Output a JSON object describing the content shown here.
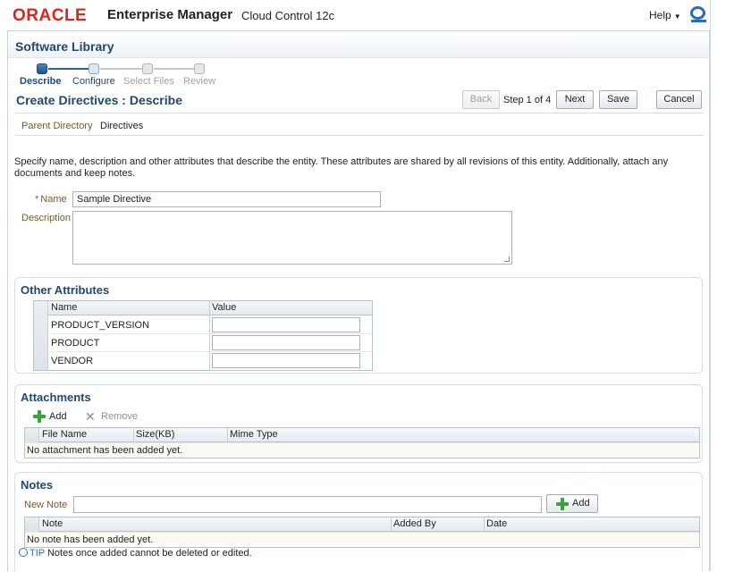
{
  "header": {
    "brand": "ORACLE",
    "product": "Enterprise Manager",
    "edition": "Cloud Control 12c",
    "help_label": "Help"
  },
  "page": {
    "title": "Software Library",
    "subtitle": "Create Directives : Describe",
    "step_info": "Step 1 of 4"
  },
  "train": {
    "steps": [
      {
        "label": "Describe",
        "state": "active"
      },
      {
        "label": "Configure",
        "state": "next"
      },
      {
        "label": "Select Files",
        "state": "todo"
      },
      {
        "label": "Review",
        "state": "todo"
      }
    ]
  },
  "buttons": {
    "back": "Back",
    "next": "Next",
    "save": "Save",
    "cancel": "Cancel"
  },
  "breadcrumb": {
    "parent_label": "Parent Directory",
    "parent_value": "Directives"
  },
  "intro_text": "Specify name, description and other attributes that describe the entity. These attributes are shared by all revisions of this entity. Additionally, attach any documents and keep notes.",
  "form": {
    "name_label": "Name",
    "name_value": "Sample Directive",
    "description_label": "Description",
    "description_value": ""
  },
  "other_attributes": {
    "title": "Other Attributes",
    "columns": [
      "Name",
      "Value"
    ],
    "rows": [
      {
        "name": "PRODUCT_VERSION",
        "value": ""
      },
      {
        "name": "PRODUCT",
        "value": ""
      },
      {
        "name": "VENDOR",
        "value": ""
      }
    ]
  },
  "attachments": {
    "title": "Attachments",
    "add_label": "Add",
    "remove_label": "Remove",
    "columns": [
      "File Name",
      "Size(KB)",
      "Mime Type"
    ],
    "empty_text": "No attachment has been added yet."
  },
  "notes": {
    "title": "Notes",
    "new_note_label": "New Note",
    "new_note_value": "",
    "add_label": "Add",
    "columns": [
      "Note",
      "Added By",
      "Date"
    ],
    "empty_text": "No note has been added yet.",
    "tip_label": "TIP",
    "tip_text": "Notes once added cannot be deleted or edited."
  },
  "colors": {
    "oracle_red": "#e2231a",
    "heading_blue": "#24476b",
    "label_brown": "#7a5a2a"
  }
}
